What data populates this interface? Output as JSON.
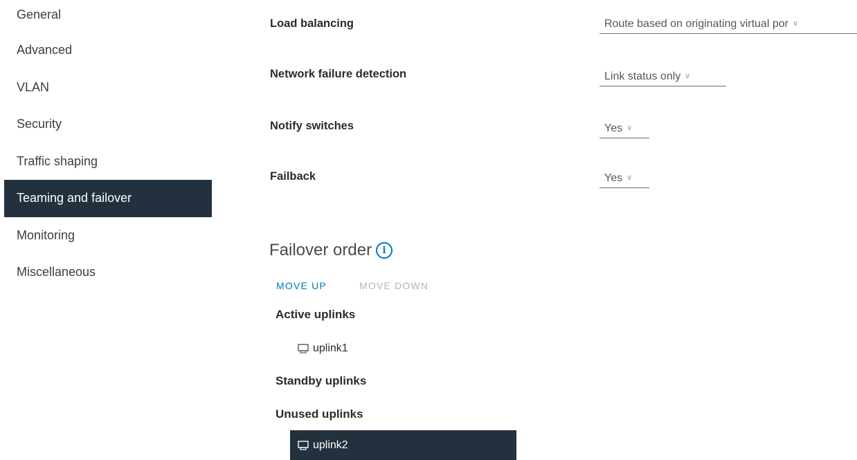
{
  "sidebar": {
    "items": [
      {
        "label": "General",
        "active": false
      },
      {
        "label": "Advanced",
        "active": false
      },
      {
        "label": "VLAN",
        "active": false
      },
      {
        "label": "Security",
        "active": false
      },
      {
        "label": "Traffic shaping",
        "active": false
      },
      {
        "label": "Teaming and failover",
        "active": true
      },
      {
        "label": "Monitoring",
        "active": false
      },
      {
        "label": "Miscellaneous",
        "active": false
      }
    ]
  },
  "settings": {
    "load_balancing": {
      "label": "Load balancing",
      "value": "Route based on originating virtual por"
    },
    "network_failure_detection": {
      "label": "Network failure detection",
      "value": "Link status only"
    },
    "notify_switches": {
      "label": "Notify switches",
      "value": "Yes"
    },
    "failback": {
      "label": "Failback",
      "value": "Yes"
    }
  },
  "failover_order": {
    "title": "Failover order",
    "info_icon": "info-icon",
    "move_up": "MOVE UP",
    "move_down": "MOVE DOWN",
    "active_uplinks": {
      "label": "Active uplinks",
      "items": [
        "uplink1"
      ]
    },
    "standby_uplinks": {
      "label": "Standby uplinks",
      "items": []
    },
    "unused_uplinks": {
      "label": "Unused uplinks",
      "items": [
        "uplink2"
      ]
    }
  },
  "colors": {
    "selected_bg": "#23303d",
    "link_blue": "#0079b8",
    "disabled_text": "#b3b3b3"
  },
  "icons": {
    "uplink": "uplink-icon",
    "chevron": "chevron-down-icon"
  }
}
